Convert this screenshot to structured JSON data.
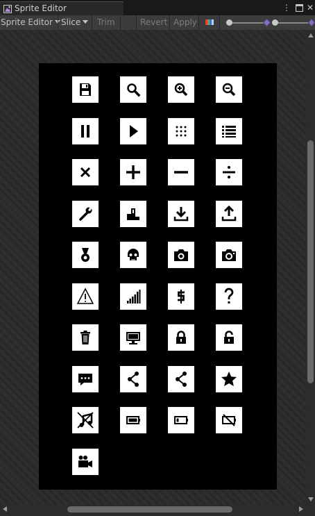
{
  "window": {
    "title": "Sprite Editor"
  },
  "toolbar": {
    "sprite_editor_label": "Sprite Editor",
    "slice_label": "Slice",
    "trim_label": "Trim",
    "revert_label": "Revert",
    "apply_label": "Apply"
  },
  "colors": {
    "title_bar": "#191919",
    "toolbar": "#3c3c3c",
    "sheet_background": "#000000",
    "icon_tile": "#ffffff",
    "icon_glyph": "#000000"
  },
  "sprite_sheet": {
    "columns": 4,
    "icons": [
      "save-icon",
      "search-icon",
      "zoom-in-icon",
      "zoom-out-icon",
      "pause-icon",
      "play-icon",
      "grid-dots-icon",
      "list-icon",
      "multiply-icon",
      "plus-icon",
      "minus-icon",
      "divide-icon",
      "wrench-icon",
      "podium-icon",
      "download-icon",
      "upload-icon",
      "medal-icon",
      "skull-icon",
      "camera-icon",
      "camera-alt-icon",
      "warning-icon",
      "signal-bars-icon",
      "dollar-icon",
      "question-icon",
      "trash-icon",
      "monitor-icon",
      "lock-icon",
      "unlock-icon",
      "chat-bubble-icon",
      "share-icon",
      "share-alt-icon",
      "star-icon",
      "music-off-icon",
      "battery-full-icon",
      "battery-low-icon",
      "battery-off-icon",
      "video-camera-icon"
    ]
  }
}
